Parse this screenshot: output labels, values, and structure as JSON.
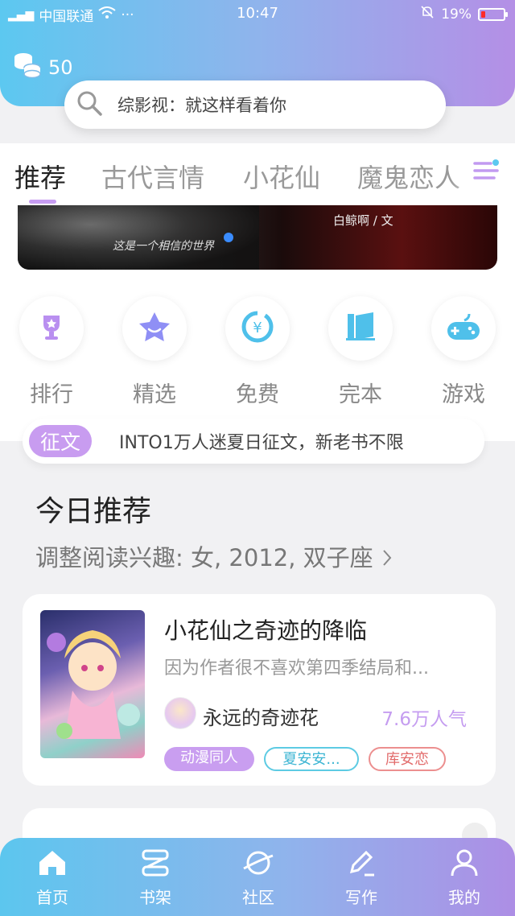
{
  "status_bar": {
    "carrier": "中国联通",
    "time": "10:47",
    "battery": "19%",
    "battery_level": 0.19,
    "dots": "···"
  },
  "header": {
    "coin_count": "50",
    "search_placeholder": "综影视：就这样看着你"
  },
  "tabs": [
    {
      "label": "推荐"
    },
    {
      "label": "古代言情"
    },
    {
      "label": "小花仙"
    },
    {
      "label": "魔鬼恋人"
    }
  ],
  "banner": {
    "author": "白鲸啊 / 文",
    "caption": "这是一个相信的世界"
  },
  "quick_links": [
    {
      "label": "排行",
      "icon": "trophy-icon"
    },
    {
      "label": "精选",
      "icon": "star-icon"
    },
    {
      "label": "免费",
      "icon": "yen-icon"
    },
    {
      "label": "完本",
      "icon": "book-icon"
    },
    {
      "label": "游戏",
      "icon": "gamepad-icon"
    }
  ],
  "notice": {
    "tag": "征文",
    "text": "INTO1万人迷夏日征文，新老书不限"
  },
  "recommend": {
    "title": "今日推荐",
    "subtitle": "调整阅读兴趣: 女, 2012, 双子座",
    "book": {
      "title": "小花仙之奇迹的降临",
      "description": "因为作者很不喜欢第四季结局和...",
      "author": "永远的奇迹花",
      "popularity": "7.6万人气",
      "tags": [
        "动漫同人",
        "夏安安...",
        "库安恋"
      ]
    }
  },
  "bottom_nav": [
    {
      "label": "首页",
      "icon": "home-icon"
    },
    {
      "label": "书架",
      "icon": "bookshelf-icon"
    },
    {
      "label": "社区",
      "icon": "planet-icon"
    },
    {
      "label": "写作",
      "icon": "pen-icon"
    },
    {
      "label": "我的",
      "icon": "user-icon"
    }
  ],
  "colors": {
    "accent_purple": "#c89cf0",
    "accent_blue": "#5cc8f0",
    "tag_cyan": "#5dcbe3",
    "tag_red": "#ec8f8f"
  }
}
